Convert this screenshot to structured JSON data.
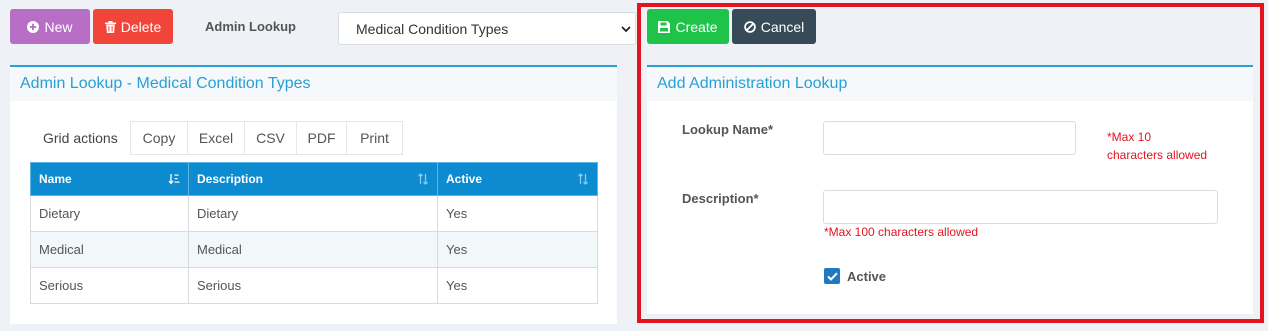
{
  "toolbar": {
    "new_label": "New",
    "delete_label": "Delete",
    "lookup_label": "Admin Lookup",
    "lookup_selected": "Medical Condition Types",
    "create_label": "Create",
    "cancel_label": "Cancel"
  },
  "list_panel": {
    "title": "Admin Lookup - Medical Condition Types",
    "grid_actions_label": "Grid actions",
    "grid_actions": [
      "Copy",
      "Excel",
      "CSV",
      "PDF",
      "Print"
    ],
    "columns": [
      "Name",
      "Description",
      "Active"
    ],
    "rows": [
      [
        "Dietary",
        "Dietary",
        "Yes"
      ],
      [
        "Medical",
        "Medical",
        "Yes"
      ],
      [
        "Serious",
        "Serious",
        "Yes"
      ]
    ]
  },
  "form_panel": {
    "title": "Add Administration Lookup",
    "lookup_name_label": "Lookup Name*",
    "lookup_name_value": "",
    "lookup_name_hint_line1": "*Max 10",
    "lookup_name_hint_line2": "characters allowed",
    "description_label": "Description*",
    "description_value": "",
    "description_hint": "*Max 100 characters allowed",
    "active_label": "Active",
    "active_checked": true
  },
  "colors": {
    "accent": "#2a9fd6",
    "header_blue": "#0d8bd1",
    "new_button": "#b66fc4",
    "delete_button": "#f1453a",
    "create_button": "#1fc349",
    "cancel_button": "#364a58",
    "highlight_frame": "#e3141f"
  },
  "icons": {
    "new": "plus-circle-icon",
    "delete": "trash-icon",
    "create": "save-icon",
    "cancel": "ban-icon",
    "select": "chevron-down-icon",
    "sort_name": "sort-alpha-icon",
    "sort": "sort-icon",
    "checkbox": "check-icon"
  }
}
